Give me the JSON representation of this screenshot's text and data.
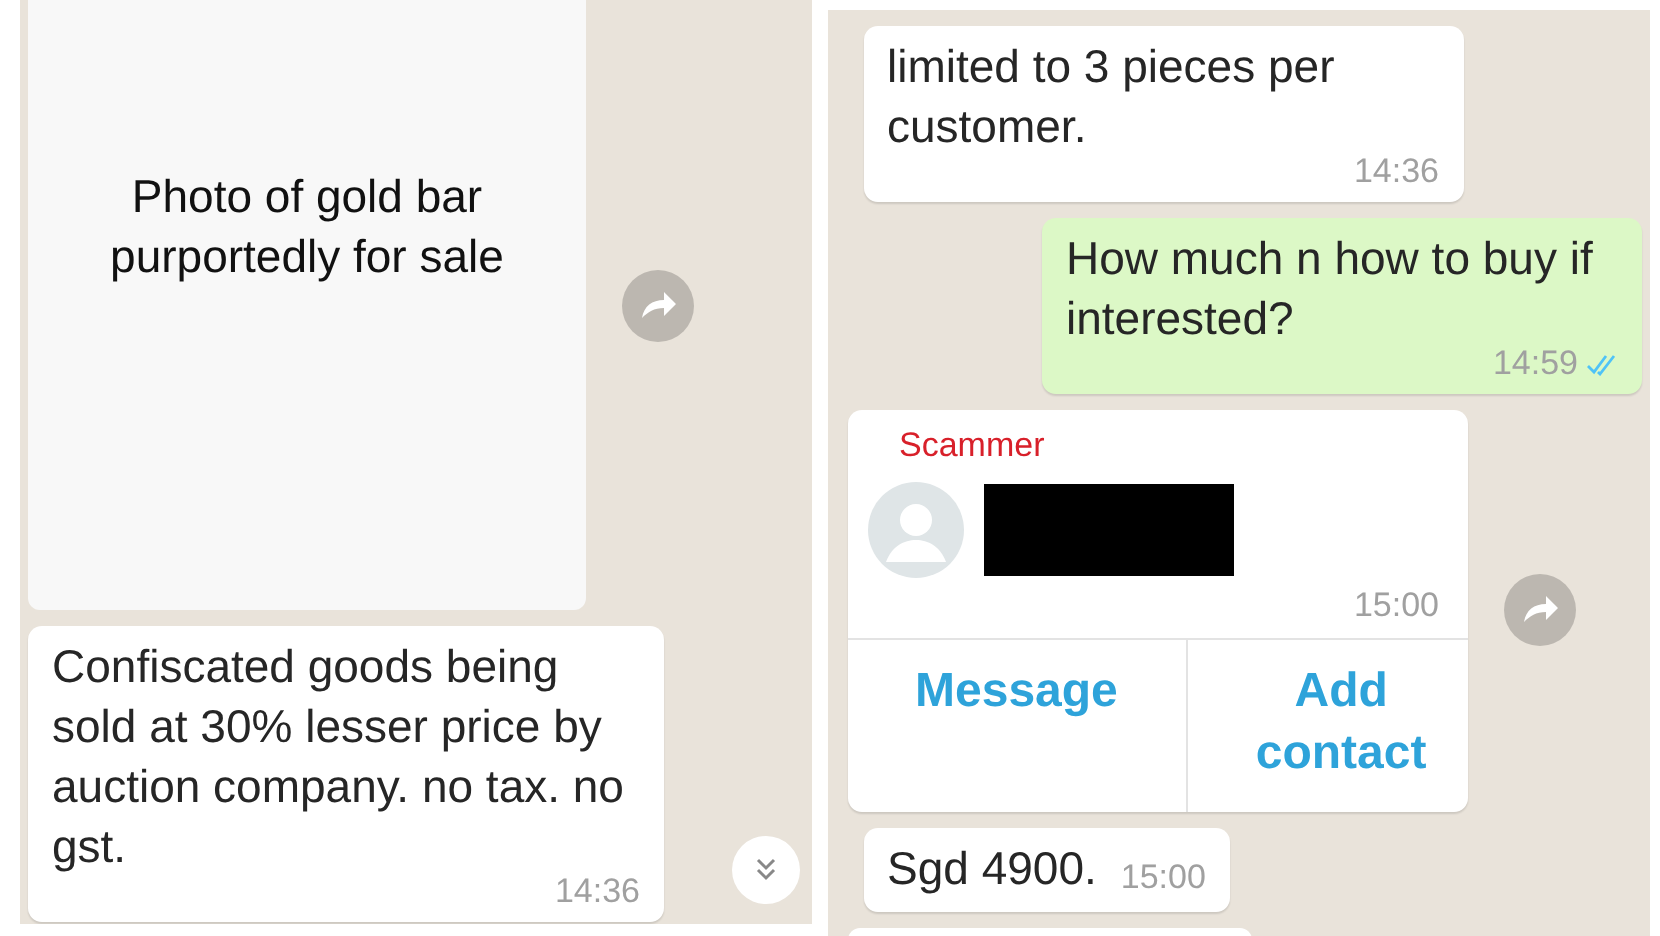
{
  "panels": [
    {
      "messages": [
        {
          "kind": "image",
          "caption": "Photo of gold bar purportedly for sale",
          "forward": true
        },
        {
          "kind": "incoming",
          "text": "Confiscated goods being sold at 30% lesser price by auction company. no tax. no gst.",
          "time": "14:36"
        }
      ],
      "scroll_button": true
    },
    {
      "messages": [
        {
          "kind": "incoming",
          "text": "limited to 3 pieces per customer.",
          "time": "14:36"
        },
        {
          "kind": "outgoing",
          "text": "How much n how to buy if interested?",
          "time": "14:59",
          "read": true
        },
        {
          "kind": "contact",
          "sender": "Scammer",
          "time": "15:00",
          "forward": true,
          "actions": [
            "Message",
            "Add contact"
          ]
        },
        {
          "kind": "short",
          "text": "Sgd 4900.",
          "time": "15:00"
        },
        {
          "kind": "partial"
        }
      ],
      "scroll_button": false
    }
  ]
}
